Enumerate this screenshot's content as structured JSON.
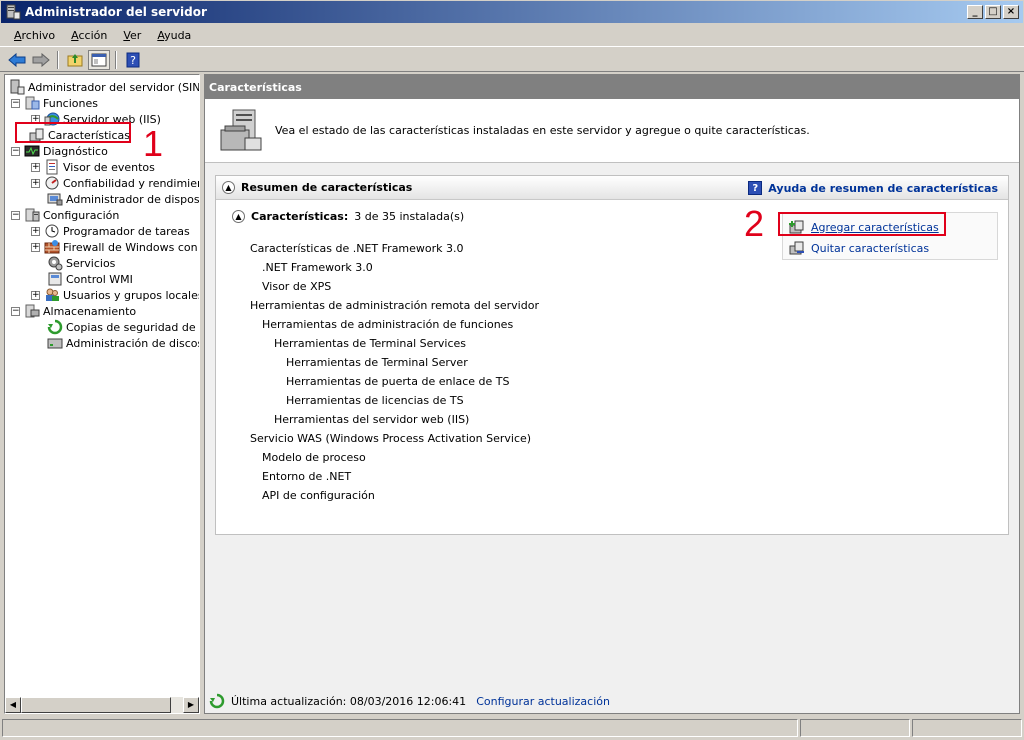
{
  "window": {
    "title": "Administrador del servidor"
  },
  "menu": [
    {
      "label": "Archivo",
      "mnemonic": "A",
      "rest": "rchivo"
    },
    {
      "label": "Acción",
      "mnemonic": "A",
      "rest": "cción"
    },
    {
      "label": "Ver",
      "mnemonic": "V",
      "rest": "er"
    },
    {
      "label": "Ayuda",
      "mnemonic": "A",
      "rest": "yuda"
    }
  ],
  "tree": {
    "root": "Administrador del servidor (SINTES",
    "funciones": "Funciones",
    "servidor_web": "Servidor web (IIS)",
    "caracteristicas": "Características",
    "diagnostico": "Diagnóstico",
    "visor_eventos": "Visor de eventos",
    "confiabilidad": "Confiabilidad y rendimiento",
    "admin_dispositivos": "Administrador de dispositiv",
    "configuracion": "Configuración",
    "programador": "Programador de tareas",
    "firewall": "Firewall de Windows con se",
    "servicios": "Servicios",
    "wmi": "Control WMI",
    "usuarios": "Usuarios y grupos locales",
    "almacenamiento": "Almacenamiento",
    "copias": "Copias de seguridad de Wir",
    "discos": "Administración de discos"
  },
  "panel": {
    "title": "Características",
    "intro": "Vea el estado de las características instaladas en este servidor y agregue o quite características.",
    "section_title": "Resumen de características",
    "help_link": "Ayuda de resumen de características",
    "features_label": "Características:",
    "features_count": "3 de 35 instalada(s)",
    "add_link": "Agregar características",
    "remove_link": "Quitar características",
    "features": [
      "Características de .NET Framework 3.0",
      ".NET Framework 3.0",
      "Visor de XPS",
      "Herramientas de administración remota del servidor",
      "Herramientas de administración de funciones",
      "Herramientas de Terminal Services",
      "Herramientas de Terminal Server",
      "Herramientas de puerta de enlace de TS",
      "Herramientas de licencias de TS",
      "Herramientas del servidor web (IIS)",
      "Servicio WAS (Windows Process Activation Service)",
      "Modelo de proceso",
      "Entorno de .NET",
      "API de configuración"
    ],
    "last_update": "Última actualización: 08/03/2016 12:06:41",
    "config_update": "Configurar actualización"
  },
  "annotations": {
    "one": "1",
    "two": "2"
  },
  "colors": {
    "accent_link": "#003399",
    "annotation_red": "#e0001a",
    "title_gradient_start": "#0a246a"
  }
}
